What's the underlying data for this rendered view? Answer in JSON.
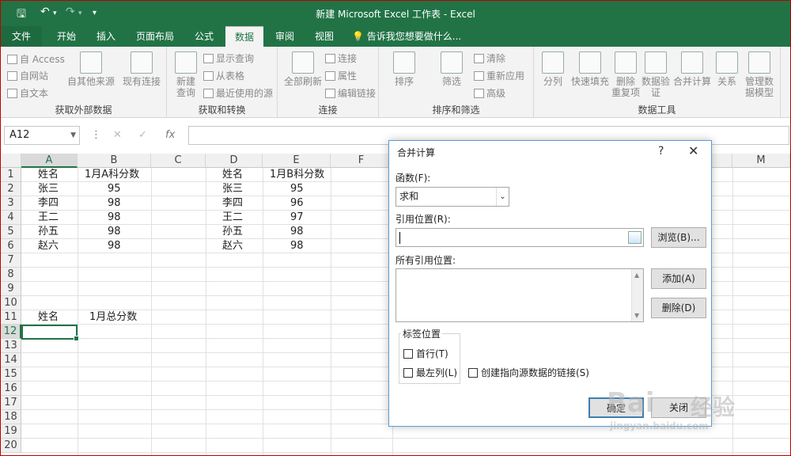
{
  "window": {
    "title": "新建 Microsoft Excel 工作表 - Excel"
  },
  "quick_access": {
    "save_icon": "save-icon",
    "undo_icon": "undo-icon",
    "redo_icon": "redo-icon",
    "customize": "▾"
  },
  "tabs": [
    {
      "label": "文件"
    },
    {
      "label": "开始"
    },
    {
      "label": "插入"
    },
    {
      "label": "页面布局"
    },
    {
      "label": "公式"
    },
    {
      "label": "数据"
    },
    {
      "label": "审阅"
    },
    {
      "label": "视图"
    }
  ],
  "tell_me": "告诉我您想要做什么...",
  "ribbon": {
    "groups": [
      {
        "label": "获取外部数据",
        "items": [
          "自 Access",
          "自网站",
          "自文本",
          "自其他来源",
          "现有连接"
        ]
      },
      {
        "label": "获取和转换",
        "items": [
          "新建\n查询",
          "显示查询",
          "从表格",
          "最近使用的源"
        ]
      },
      {
        "label": "连接",
        "items": [
          "全部刷新",
          "连接",
          "属性",
          "编辑链接"
        ]
      },
      {
        "label": "排序和筛选",
        "items": [
          "排序",
          "筛选",
          "清除",
          "重新应用",
          "高级"
        ]
      },
      {
        "label": "数据工具",
        "items": [
          "分列",
          "快速填充",
          "删除\n重复项",
          "数据验\n证",
          "合并计算",
          "关系",
          "管理数\n据模型"
        ]
      }
    ]
  },
  "formula_bar": {
    "name_box": "A12",
    "fx": "fx"
  },
  "columns": [
    "A",
    "B",
    "C",
    "D",
    "E",
    "F",
    "M"
  ],
  "rows": [
    "1",
    "2",
    "3",
    "4",
    "5",
    "6",
    "7",
    "8",
    "9",
    "10",
    "11",
    "12",
    "13",
    "14",
    "15",
    "16",
    "17",
    "18",
    "19",
    "20"
  ],
  "table_a": {
    "header": [
      "姓名",
      "1月A科分数"
    ],
    "rows": [
      [
        "张三",
        "95"
      ],
      [
        "李四",
        "98"
      ],
      [
        "王二",
        "98"
      ],
      [
        "孙五",
        "98"
      ],
      [
        "赵六",
        "98"
      ]
    ]
  },
  "table_b": {
    "header": [
      "姓名",
      "1月B科分数"
    ],
    "rows": [
      [
        "张三",
        "95"
      ],
      [
        "李四",
        "96"
      ],
      [
        "王二",
        "97"
      ],
      [
        "孙五",
        "98"
      ],
      [
        "赵六",
        "98"
      ]
    ]
  },
  "summary": {
    "header": [
      "姓名",
      "1月总分数"
    ]
  },
  "dialog": {
    "title": "合并计算",
    "help": "?",
    "close": "✕",
    "function_label": "函数(F):",
    "function_value": "求和",
    "reference_label": "引用位置(R):",
    "reference_value": "",
    "browse": "浏览(B)...",
    "all_references_label": "所有引用位置:",
    "add": "添加(A)",
    "delete": "删除(D)",
    "labels_group": "标签位置",
    "top_row": "首行(T)",
    "left_column": "最左列(L)",
    "create_links": "创建指向源数据的链接(S)",
    "ok": "确定",
    "close_btn": "关闭"
  },
  "watermark": {
    "line1": "Bai",
    "line2": "经验",
    "url": "jingyan.baidu.com"
  }
}
